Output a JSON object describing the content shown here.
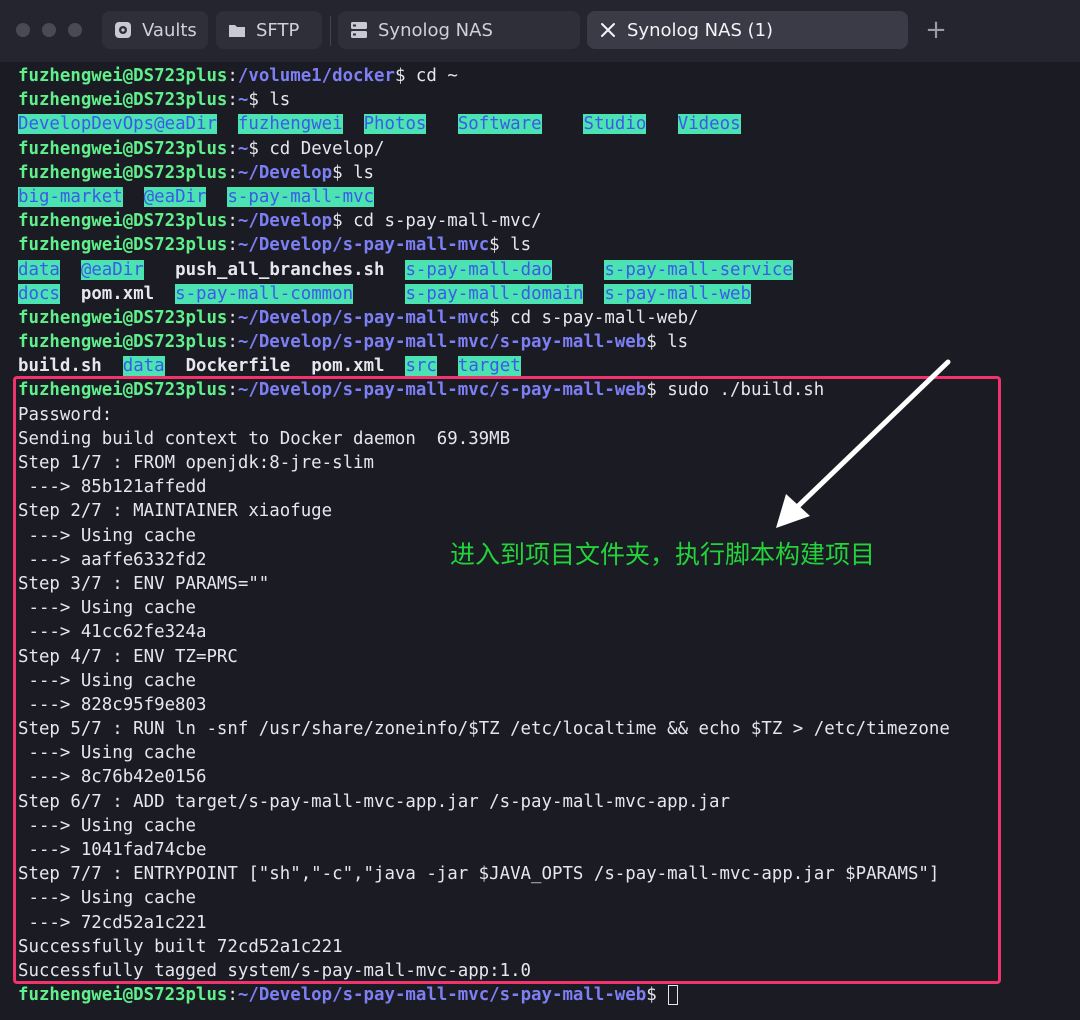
{
  "tabs": [
    {
      "label": "Vaults",
      "icon": "vault-icon"
    },
    {
      "label": "SFTP",
      "icon": "folder-icon"
    },
    {
      "label": "Synolog NAS",
      "icon": "server-icon"
    },
    {
      "label": "Synolog NAS (1)",
      "icon": "close-icon"
    }
  ],
  "new_tab": "+",
  "prompt_user": "fuzhengwei@DS723plus",
  "colon": ":",
  "dollar": "$",
  "lines": [
    {
      "path": "/volume1/docker",
      "cmd": " cd ~"
    },
    {
      "path": "~",
      "cmd": " ls"
    },
    {
      "ls": [
        [
          "Develop",
          "dir"
        ],
        [
          "DevOps",
          "dir"
        ],
        [
          "@eaDir",
          "dir"
        ],
        [
          "fuzhengwei",
          "dir"
        ],
        [
          "Photos",
          "dir"
        ],
        [
          "Software",
          "dir"
        ],
        [
          "Studio",
          "dir"
        ],
        [
          "Videos",
          "dir"
        ]
      ],
      "cols": [
        0,
        6,
        13,
        21,
        33,
        42,
        54,
        63
      ]
    },
    {
      "path": "~",
      "cmd": " cd Develop/"
    },
    {
      "path": "~/Develop",
      "cmd": " ls"
    },
    {
      "ls": [
        [
          "big-market",
          "dir"
        ],
        [
          "@eaDir",
          "dir"
        ],
        [
          "s-pay-mall-mvc",
          "dir"
        ]
      ],
      "cols": [
        0,
        12,
        20
      ]
    },
    {
      "path": "~/Develop",
      "cmd": " cd s-pay-mall-mvc/"
    },
    {
      "path": "~/Develop/s-pay-mall-mvc",
      "cmd": " ls"
    },
    {
      "ls": [
        [
          "data",
          "dir"
        ],
        [
          "@eaDir",
          "dir"
        ],
        [
          "push_all_branches.sh",
          "file"
        ],
        [
          "s-pay-mall-dao",
          "dir"
        ],
        [
          "s-pay-mall-service",
          "dir"
        ]
      ],
      "cols": [
        0,
        6,
        15,
        37,
        56
      ]
    },
    {
      "ls": [
        [
          "docs",
          "dir"
        ],
        [
          "pom.xml",
          "file"
        ],
        [
          "s-pay-mall-common",
          "dir"
        ],
        [
          "s-pay-mall-domain",
          "dir"
        ],
        [
          "s-pay-mall-web",
          "dir"
        ]
      ],
      "cols": [
        0,
        6,
        15,
        37,
        56
      ]
    },
    {
      "path": "~/Develop/s-pay-mall-mvc",
      "cmd": " cd s-pay-mall-web/"
    },
    {
      "path": "~/Develop/s-pay-mall-mvc/s-pay-mall-web",
      "cmd": " ls"
    },
    {
      "ls": [
        [
          "build.sh",
          "file"
        ],
        [
          "data",
          "dir"
        ],
        [
          "Dockerfile",
          "file"
        ],
        [
          "pom.xml",
          "file"
        ],
        [
          "src",
          "dir"
        ],
        [
          "target",
          "dir"
        ]
      ],
      "cols": [
        0,
        10,
        16,
        28,
        37,
        42
      ]
    },
    {
      "path": "~/Develop/s-pay-mall-mvc/s-pay-mall-web",
      "cmd": " sudo ./build.sh"
    },
    {
      "text": "Password:"
    },
    {
      "text": "Sending build context to Docker daemon  69.39MB"
    },
    {
      "text": "Step 1/7 : FROM openjdk:8-jre-slim"
    },
    {
      "text": " ---> 85b121affedd"
    },
    {
      "text": "Step 2/7 : MAINTAINER xiaofuge"
    },
    {
      "text": " ---> Using cache"
    },
    {
      "text": " ---> aaffe6332fd2"
    },
    {
      "text": "Step 3/7 : ENV PARAMS=\"\""
    },
    {
      "text": " ---> Using cache"
    },
    {
      "text": " ---> 41cc62fe324a"
    },
    {
      "text": "Step 4/7 : ENV TZ=PRC"
    },
    {
      "text": " ---> Using cache"
    },
    {
      "text": " ---> 828c95f9e803"
    },
    {
      "text": "Step 5/7 : RUN ln -snf /usr/share/zoneinfo/$TZ /etc/localtime && echo $TZ > /etc/timezone"
    },
    {
      "text": " ---> Using cache"
    },
    {
      "text": " ---> 8c76b42e0156"
    },
    {
      "text": "Step 6/7 : ADD target/s-pay-mall-mvc-app.jar /s-pay-mall-mvc-app.jar"
    },
    {
      "text": " ---> Using cache"
    },
    {
      "text": " ---> 1041fad74cbe"
    },
    {
      "text": "Step 7/7 : ENTRYPOINT [\"sh\",\"-c\",\"java -jar $JAVA_OPTS /s-pay-mall-mvc-app.jar $PARAMS\"]"
    },
    {
      "text": " ---> Using cache"
    },
    {
      "text": " ---> 72cd52a1c221"
    },
    {
      "text": "Successfully built 72cd52a1c221"
    },
    {
      "text": "Successfully tagged system/s-pay-mall-mvc-app:1.0"
    },
    {
      "path": "~/Develop/s-pay-mall-mvc/s-pay-mall-web",
      "cmd": " ",
      "cursor": true
    }
  ],
  "annotation": "进入到项目文件夹，执行脚本构建项目",
  "colors": {
    "user": "#5ff08c",
    "path": "#7d7ff5",
    "dir_bg": "#4be3b2",
    "dir_fg": "#3c5ae8",
    "highlight": "#f0336d",
    "annotation": "#22d33a"
  }
}
